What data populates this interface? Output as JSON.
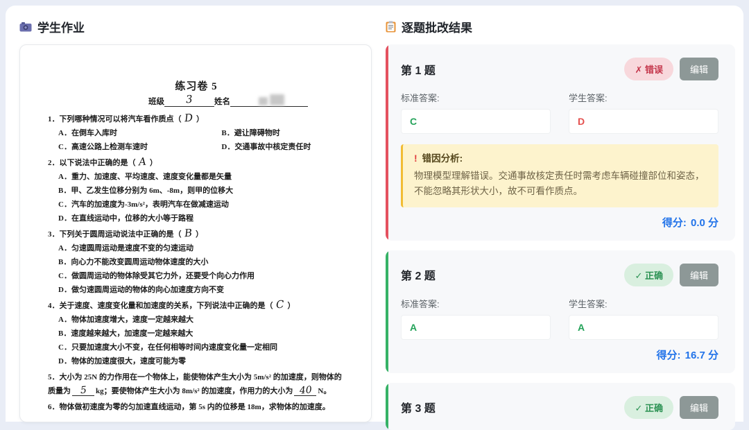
{
  "left_panel": {
    "icon": "camera",
    "title": "学生作业"
  },
  "paper": {
    "title": "练习卷 5",
    "class_label": "班级",
    "class_value": "3",
    "name_label": "姓名",
    "questions": [
      {
        "stem": [
          {
            "t": "text",
            "v": "1．下列哪种情况可以将汽车看作质点（ "
          },
          {
            "t": "hand",
            "v": "D"
          },
          {
            "t": "text",
            "v": " ）"
          }
        ],
        "option_cols": 2,
        "options": [
          "A．在倒车入库时",
          "B．避让障碍物时",
          "C．高速公路上检测车速时",
          "D．交通事故中核定责任时"
        ]
      },
      {
        "stem": [
          {
            "t": "text",
            "v": "2．以下说法中正确的是（ "
          },
          {
            "t": "hand",
            "v": "A"
          },
          {
            "t": "text",
            "v": " ）"
          }
        ],
        "option_cols": 1,
        "options": [
          "A．重力、加速度、平均速度、速度变化量都是矢量",
          "B．甲、乙发生位移分别为 6m、-8m，则甲的位移大",
          "C．汽车的加速度为-3m/s²，表明汽车在做减速运动",
          "D．在直线运动中，位移的大小等于路程"
        ]
      },
      {
        "stem": [
          {
            "t": "text",
            "v": "3．下列关于圆周运动说法中正确的是（ "
          },
          {
            "t": "hand",
            "v": "B"
          },
          {
            "t": "text",
            "v": " ）"
          }
        ],
        "option_cols": 1,
        "options": [
          "A．匀速圆周运动是速度不变的匀速运动",
          "B．向心力不能改变圆周运动物体速度的大小",
          "C．做圆周运动的物体除受其它力外，还要受个向心力作用",
          "D．做匀速圆周运动的物体的向心加速度方向不变"
        ]
      },
      {
        "stem": [
          {
            "t": "text",
            "v": "4．关于速度、速度变化量和加速度的关系，下列说法中正确的是（ "
          },
          {
            "t": "hand",
            "v": "C"
          },
          {
            "t": "text",
            "v": " ）"
          }
        ],
        "option_cols": 1,
        "options": [
          "A．物体加速度增大，速度一定越来越大",
          "B．速度越来越大，加速度一定越来越大",
          "C．只要加速度大小不变，在任何相等时间内速度变化量一定相同",
          "D．物体的加速度很大，速度可能为零"
        ]
      },
      {
        "stem": [
          {
            "t": "text",
            "v": "5．大小为 25N 的力作用在一个物体上，能使物体产生大小为 5m/s² 的加速度，则物体的质量为"
          },
          {
            "t": "blank",
            "v": "5"
          },
          {
            "t": "text",
            "v": "kg；要使物体产生大小为 8m/s² 的加速度，作用力的大小为"
          },
          {
            "t": "blank",
            "v": "40"
          },
          {
            "t": "text",
            "v": "N。"
          }
        ],
        "option_cols": 1,
        "options": []
      },
      {
        "stem": [
          {
            "t": "text",
            "v": "6．物体做初速度为零的匀加速直线运动，第 5s 内的位移是 18m，求物体的加速度。"
          }
        ],
        "option_cols": 1,
        "options": []
      }
    ]
  },
  "right_panel": {
    "icon": "clipboard",
    "title": "逐题批改结果",
    "labels": {
      "standard": "标准答案:",
      "student": "学生答案:",
      "edit": "编辑",
      "score": "得分:",
      "analysis_bang": "!"
    },
    "cards": [
      {
        "title": "第 1 题",
        "status": "wrong",
        "status_label": "✗ 错误",
        "standard_answer": "C",
        "student_answer": "D",
        "analysis": {
          "title": "错因分析:",
          "text": "物理模型理解错误。交通事故核定责任时需考虑车辆碰撞部位和姿态，不能忽略其形状大小，故不可看作质点。"
        },
        "score": "0.0 分"
      },
      {
        "title": "第 2 题",
        "status": "correct",
        "status_label": "✓ 正确",
        "standard_answer": "A",
        "student_answer": "A",
        "score": "16.7 分"
      },
      {
        "title": "第 3 题",
        "status": "correct",
        "status_label": "✓ 正确"
      }
    ]
  }
}
